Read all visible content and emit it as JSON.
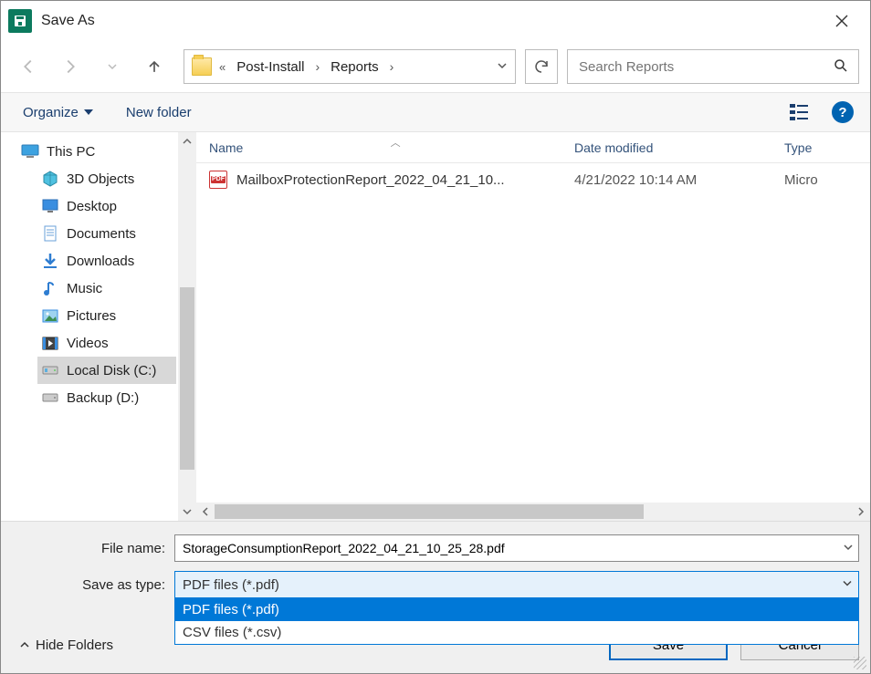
{
  "title": "Save As",
  "breadcrumbs": {
    "prefix": "«",
    "parts": [
      "Post-Install",
      "Reports"
    ]
  },
  "search": {
    "placeholder": "Search Reports"
  },
  "toolbar": {
    "organize": "Organize",
    "newfolder": "New folder"
  },
  "sidebar": {
    "root": "This PC",
    "items": [
      {
        "label": "3D Objects"
      },
      {
        "label": "Desktop"
      },
      {
        "label": "Documents"
      },
      {
        "label": "Downloads"
      },
      {
        "label": "Music"
      },
      {
        "label": "Pictures"
      },
      {
        "label": "Videos"
      },
      {
        "label": "Local Disk (C:)",
        "selected": true
      },
      {
        "label": "Backup (D:)"
      }
    ]
  },
  "columns": {
    "name": "Name",
    "date": "Date modified",
    "type": "Type"
  },
  "files": [
    {
      "name": "MailboxProtectionReport_2022_04_21_10...",
      "date": "4/21/2022 10:14 AM",
      "type": "Micro"
    }
  ],
  "form": {
    "filename_label": "File name:",
    "filename_value": "StorageConsumptionReport_2022_04_21_10_25_28.pdf",
    "type_label": "Save as type:",
    "type_selected": "PDF files (*.pdf)",
    "type_options": [
      "PDF files (*.pdf)",
      "CSV files (*.csv)"
    ]
  },
  "footer": {
    "hide": "Hide Folders",
    "save": "Save",
    "cancel": "Cancel"
  }
}
